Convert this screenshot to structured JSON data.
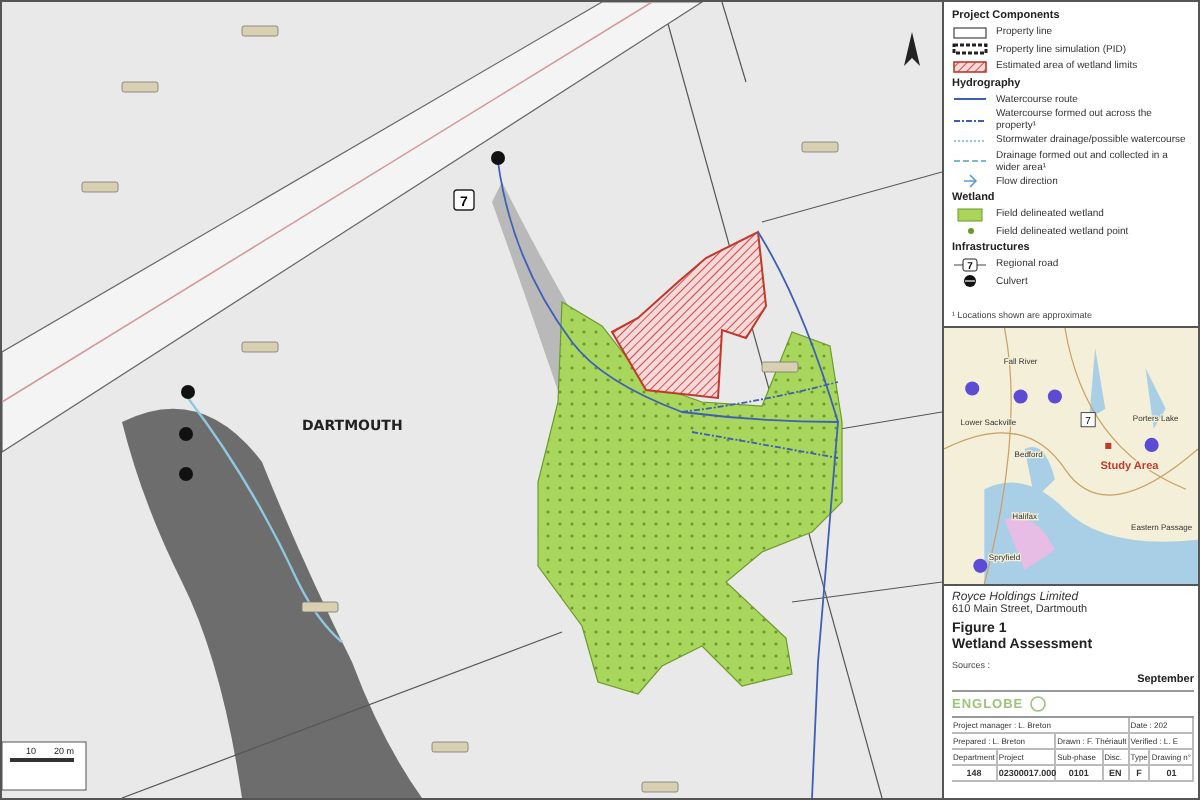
{
  "map": {
    "place_label": "DARTMOUTH",
    "road_shield": "7",
    "scale": {
      "ticks": [
        "10",
        "20 m"
      ]
    }
  },
  "legend": {
    "sections": [
      {
        "title": "Project Components",
        "items": [
          {
            "kind": "property-line",
            "label": "Property line"
          },
          {
            "kind": "property-sim",
            "label": "Property line simulation (PID)"
          },
          {
            "kind": "wetland-limit",
            "label": "Estimated area of wetland limits"
          }
        ]
      },
      {
        "title": "Hydrography",
        "items": [
          {
            "kind": "watercourse",
            "label": "Watercourse route"
          },
          {
            "kind": "watercourse-dash",
            "label": "Watercourse formed out across the property¹"
          },
          {
            "kind": "storm",
            "label": "Stormwater drainage/possible watercourse"
          },
          {
            "kind": "drainage",
            "label": "Drainage formed out and collected in a wider area¹"
          },
          {
            "kind": "flow",
            "label": "Flow direction"
          }
        ]
      },
      {
        "title": "Wetland",
        "items": [
          {
            "kind": "wetland",
            "label": "Field delineated wetland"
          },
          {
            "kind": "point",
            "label": "Field delineated wetland point"
          }
        ]
      },
      {
        "title": "Infrastructures",
        "items": [
          {
            "kind": "road",
            "label": "Regional road",
            "symbol": "7"
          },
          {
            "kind": "culvert",
            "label": "Culvert"
          }
        ]
      }
    ],
    "note": "¹ Locations shown are approximate"
  },
  "inset": {
    "places": [
      {
        "name": "Fall River"
      },
      {
        "name": "Lower Sackville"
      },
      {
        "name": "Bedford"
      },
      {
        "name": "Porters Lake"
      },
      {
        "name": "Study Area",
        "kind": "study"
      },
      {
        "name": "Eastern Passage"
      },
      {
        "name": "Halifax"
      },
      {
        "name": "Spryfield"
      }
    ],
    "road_shield": "7"
  },
  "title_block": {
    "client": "Royce Holdings Limited",
    "address": "610 Main Street, Dartmouth",
    "figure": "Figure 1",
    "title": "Wetland Assessment",
    "sources": "Sources :",
    "date": "September",
    "logo": "ENGLOBE",
    "signoff": {
      "manager": "Project manager : L. Breton",
      "date": "Date : 202",
      "prepared": "Prepared : L. Breton",
      "drawn": "Drawn : F. Thériault",
      "verified": "Verified : L. E"
    },
    "columns": [
      "Department",
      "Project",
      "Sub-phase",
      "Disc.",
      "Type",
      "Drawing n°"
    ],
    "values": [
      "148",
      "02300017.000",
      "0101",
      "EN",
      "F",
      "01"
    ]
  }
}
